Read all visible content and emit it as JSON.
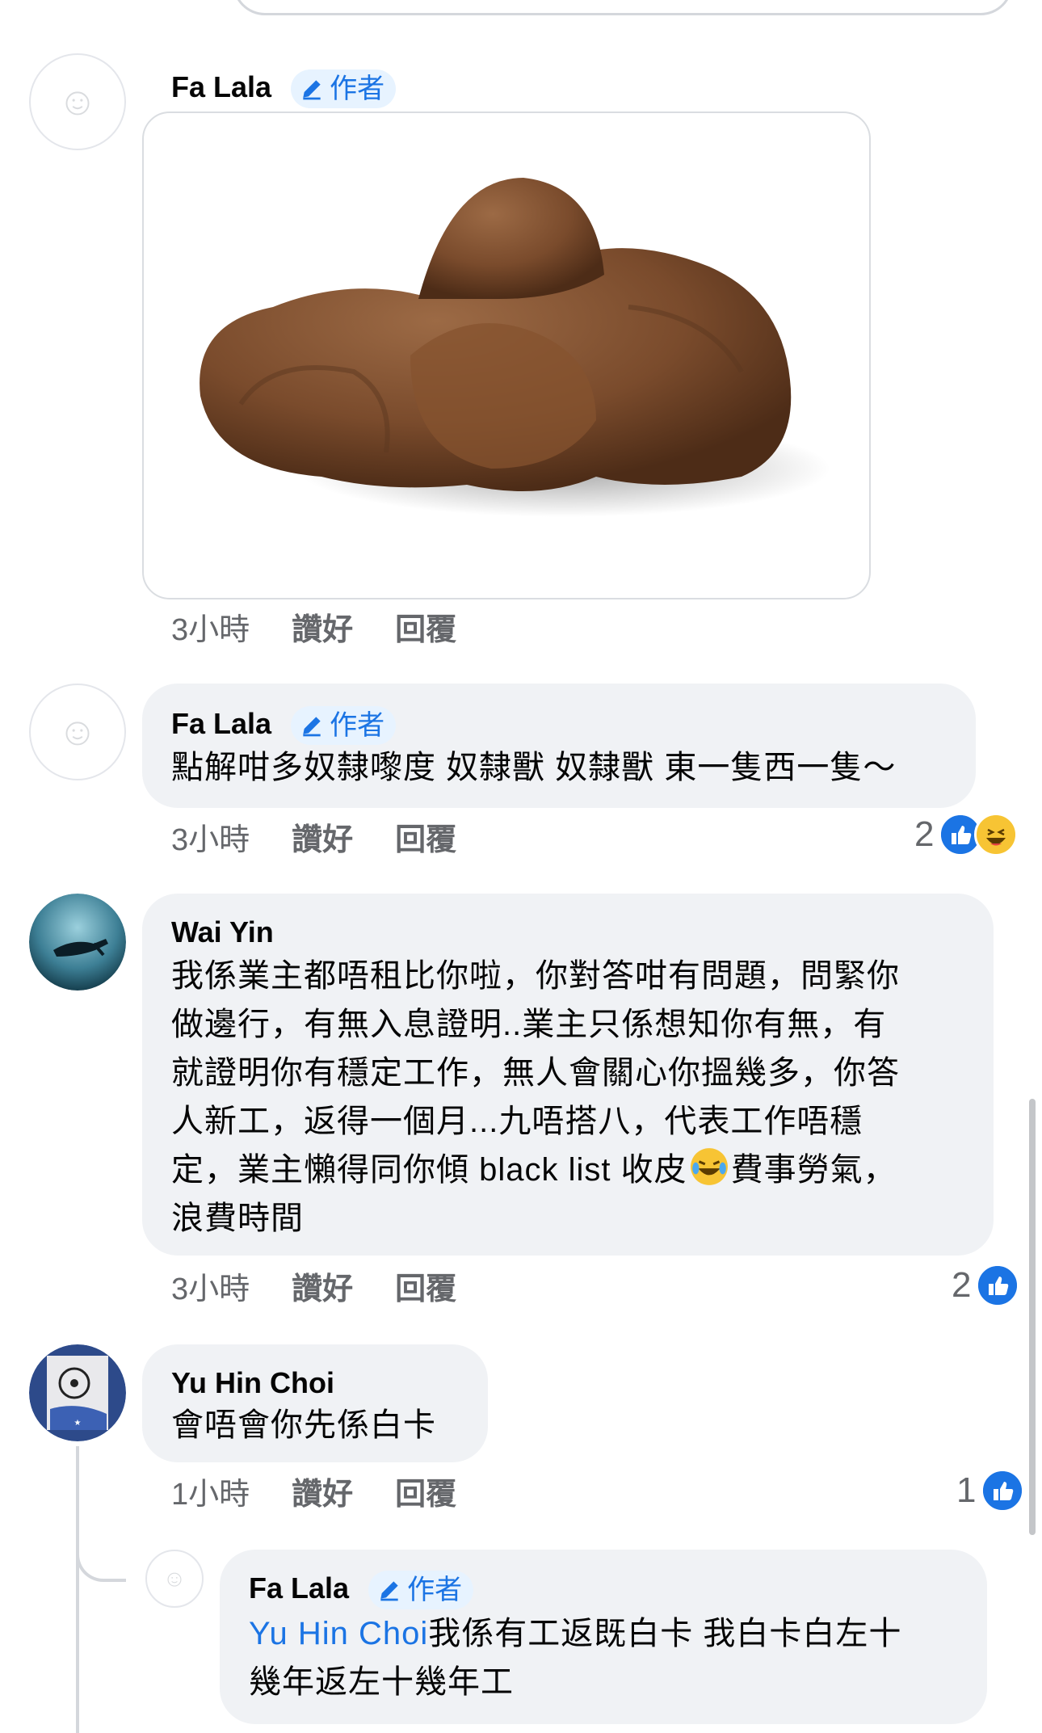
{
  "comments": [
    {
      "name": "Fa Lala",
      "author_label": "作者",
      "meta": {
        "time": "3小時",
        "like": "讚好",
        "reply": "回覆"
      }
    },
    {
      "name": "Fa Lala",
      "author_label": "作者",
      "text": "點解咁多奴隸嚟度 奴隸獸 奴隸獸 東一隻西一隻～",
      "meta": {
        "time": "3小時",
        "like": "讚好",
        "reply": "回覆"
      },
      "reaction_count": "2"
    },
    {
      "name": "Wai Yin",
      "text_lines": [
        "我係業主都唔租比你啦，你對答咁有問題，問緊你",
        "做邊行，有無入息證明..業主只係想知你有無，有",
        "就證明你有穩定工作，無人會關心你搵幾多，你答",
        "人新工，返得一個月...九唔搭八，代表工作唔穩",
        "定，業主懶得同你傾 black list 收皮",
        "費事勞氣，",
        "浪費時間"
      ],
      "meta": {
        "time": "3小時",
        "like": "讚好",
        "reply": "回覆"
      },
      "reaction_count": "2"
    },
    {
      "name": "Yu Hin Choi",
      "text": "會唔會你先係白卡",
      "meta": {
        "time": "1小時",
        "like": "讚好",
        "reply": "回覆"
      },
      "reaction_count": "1"
    },
    {
      "name": "Fa Lala",
      "author_label": "作者",
      "mention": "Yu Hin Choi",
      "text_line1": "我係有工返既白卡 我白卡白左十",
      "text_line2": "幾年返左十幾年工"
    }
  ],
  "colors": {
    "accent": "#1b74e4",
    "bubble": "#f0f2f5",
    "meta_text": "#65676b"
  },
  "icons": [
    "pencil-icon",
    "like-icon",
    "haha-icon",
    "avatar-placeholder"
  ]
}
